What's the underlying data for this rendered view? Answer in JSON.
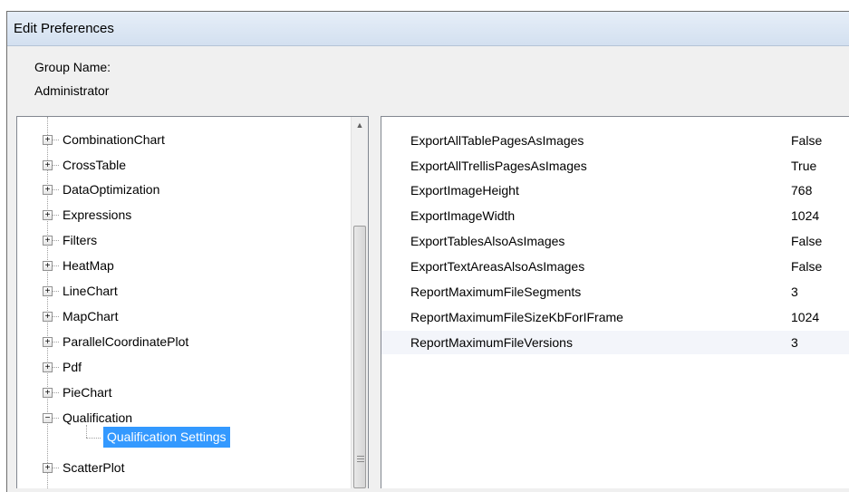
{
  "window": {
    "title": "Edit Preferences"
  },
  "group": {
    "label": "Group Name:",
    "value": "Administrator"
  },
  "tree": {
    "items": [
      {
        "label": "CombinationChart",
        "expander": "+"
      },
      {
        "label": "CrossTable",
        "expander": "+"
      },
      {
        "label": "DataOptimization",
        "expander": "+"
      },
      {
        "label": "Expressions",
        "expander": "+"
      },
      {
        "label": "Filters",
        "expander": "+"
      },
      {
        "label": "HeatMap",
        "expander": "+"
      },
      {
        "label": "LineChart",
        "expander": "+"
      },
      {
        "label": "MapChart",
        "expander": "+"
      },
      {
        "label": "ParallelCoordinatePlot",
        "expander": "+"
      },
      {
        "label": "Pdf",
        "expander": "+"
      },
      {
        "label": "PieChart",
        "expander": "+"
      },
      {
        "label": "Qualification",
        "expander": "−"
      },
      {
        "label": "ScatterPlot",
        "expander": "+"
      }
    ],
    "selected_child": "Qualification Settings"
  },
  "scrollbar": {
    "up_arrow": "▲"
  },
  "properties": {
    "rows": [
      {
        "name": "ExportAllTablePagesAsImages",
        "value": "False"
      },
      {
        "name": "ExportAllTrellisPagesAsImages",
        "value": "True"
      },
      {
        "name": "ExportImageHeight",
        "value": "768"
      },
      {
        "name": "ExportImageWidth",
        "value": "1024"
      },
      {
        "name": "ExportTablesAlsoAsImages",
        "value": "False"
      },
      {
        "name": "ExportTextAreasAlsoAsImages",
        "value": "False"
      },
      {
        "name": "ReportMaximumFileSegments",
        "value": "3"
      },
      {
        "name": "ReportMaximumFileSizeKbForIFrame",
        "value": "1024"
      },
      {
        "name": "ReportMaximumFileVersions",
        "value": "3"
      }
    ]
  },
  "colors": {
    "selection": "#3399ff",
    "title_bar": "#d9e4f2"
  }
}
